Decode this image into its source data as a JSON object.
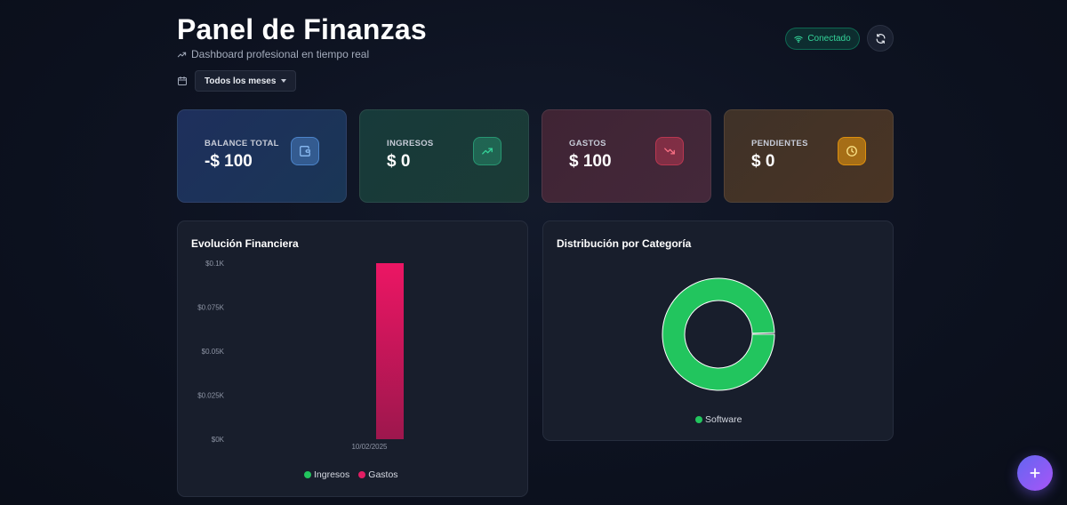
{
  "header": {
    "title": "Panel de Finanzas",
    "subtitle": "Dashboard profesional en tiempo real",
    "subtitle_icon": "trending-up-icon",
    "status_label": "Conectado",
    "status_icon": "wifi-icon",
    "refresh_icon": "refresh-icon"
  },
  "filters": {
    "calendar_icon": "calendar-icon",
    "selected_period": "Todos los meses"
  },
  "cards": [
    {
      "label": "BALANCE TOTAL",
      "value": "-$ 100",
      "icon": "wallet-icon",
      "color": "#60a5fa"
    },
    {
      "label": "INGRESOS",
      "value": "$ 0",
      "icon": "trending-up-icon",
      "color": "#34d399"
    },
    {
      "label": "GASTOS",
      "value": "$ 100",
      "icon": "trending-down-icon",
      "color": "#f43f5e"
    },
    {
      "label": "PENDIENTES",
      "value": "$ 0",
      "icon": "clock-icon",
      "color": "#f59e0b"
    }
  ],
  "panels": {
    "evolution_title": "Evolución Financiera",
    "distribution_title": "Distribución por Categoría"
  },
  "chart_data": [
    {
      "type": "bar",
      "title": "Evolución Financiera",
      "categories": [
        "10/02/2025"
      ],
      "series": [
        {
          "name": "Ingresos",
          "values": [
            0
          ],
          "color": "#22c55e"
        },
        {
          "name": "Gastos",
          "values": [
            0.1
          ],
          "color": "#e11d63"
        }
      ],
      "y_ticks": [
        "$0K",
        "$0.025K",
        "$0.05K",
        "$0.075K",
        "$0.1K"
      ],
      "ylim": [
        0,
        0.1
      ],
      "grid": false,
      "legend_position": "bottom"
    },
    {
      "type": "pie",
      "title": "Distribución por Categoría",
      "donut": true,
      "labels": [
        "Software"
      ],
      "values": [
        100
      ],
      "colors": [
        "#22c55e"
      ],
      "legend_position": "bottom"
    }
  ],
  "fab": {
    "icon": "plus-icon"
  },
  "colors": {
    "background": "#0d1220",
    "panel": "#181e2c",
    "income": "#22c55e",
    "expense": "#e11d63",
    "status": "#34d399",
    "accent": "#8b5cf6"
  }
}
